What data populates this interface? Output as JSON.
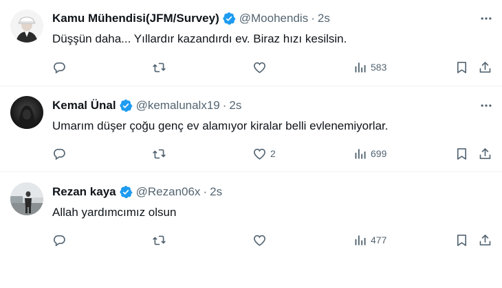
{
  "tweets": [
    {
      "name": "Kamu Mühendisi(JFM/Survey)",
      "handle": "@Moohendis",
      "dot": "·",
      "time": "2s",
      "text": "Düşşün daha... Yıllardır kazandırdı ev. Biraz hızı kesilsin.",
      "replies": "",
      "reposts": "",
      "likes": "",
      "views": "583"
    },
    {
      "name": "Kemal Ünal",
      "handle": "@kemalunalx19",
      "dot": "·",
      "time": "2s",
      "text": "Umarım düşer çoğu genç ev alamıyor kiralar belli evlenemiyorlar.",
      "replies": "",
      "reposts": "",
      "likes": "2",
      "views": "699"
    },
    {
      "name": "Rezan kaya",
      "handle": "@Rezan06x",
      "dot": "·",
      "time": "2s",
      "text": "Allah yardımcımız olsun",
      "replies": "",
      "reposts": "",
      "likes": "",
      "views": "477"
    }
  ],
  "colors": {
    "text": "#0f1419",
    "secondary": "#536471",
    "verified": "#1d9bf0",
    "divider": "#eff3f4"
  },
  "icons": [
    "verified-badge-icon",
    "more-icon",
    "reply-icon",
    "repost-icon",
    "like-icon",
    "views-icon",
    "bookmark-icon",
    "share-icon"
  ]
}
